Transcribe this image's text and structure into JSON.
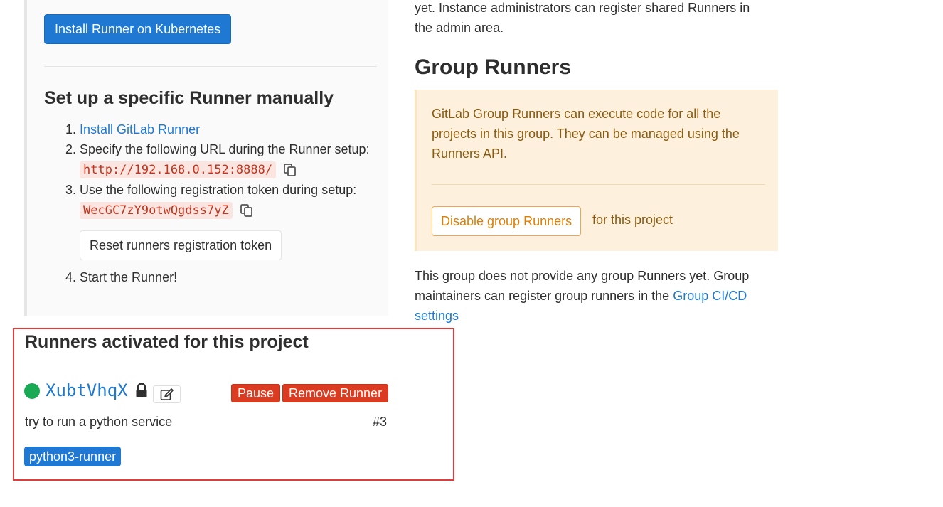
{
  "install_section": {
    "k8s_button": "Install Runner on Kubernetes",
    "heading": "Set up a specific Runner manually",
    "steps": {
      "s1_num": "1.",
      "s1_link": "Install GitLab Runner",
      "s2_num": "2.",
      "s2_text": "Specify the following URL during the Runner setup:",
      "url": "http://192.168.0.152:8888/",
      "s3_num": "3.",
      "s3_text": "Use the following registration token during setup:",
      "token": "WecGC7zY9otwQgdss7yZ",
      "reset_button": "Reset runners registration token",
      "s4_num": "4.",
      "s4_text": "Start the Runner!"
    }
  },
  "shared_section": {
    "text": "yet. Instance administrators can register shared Runners in the admin area."
  },
  "group_section": {
    "heading": "Group Runners",
    "info": "GitLab Group Runners can execute code for all the projects in this group. They can be managed using the Runners API.",
    "disable_button": "Disable group Runners",
    "for_project": "for this project",
    "none_text": "This group does not provide any group Runners yet. Group maintainers can register group runners in the ",
    "link": "Group CI/CD settings"
  },
  "activated_section": {
    "heading": "Runners activated for this project",
    "runner": {
      "name": "XubtVhqX",
      "status_color": "#1aaa55",
      "pause_button": "Pause",
      "remove_button": "Remove Runner",
      "description": "try to run a python service",
      "id": "#3",
      "tag": "python3-runner"
    }
  },
  "icons": {
    "copy": "copy-icon",
    "lock": "lock-icon",
    "edit": "edit-icon"
  }
}
